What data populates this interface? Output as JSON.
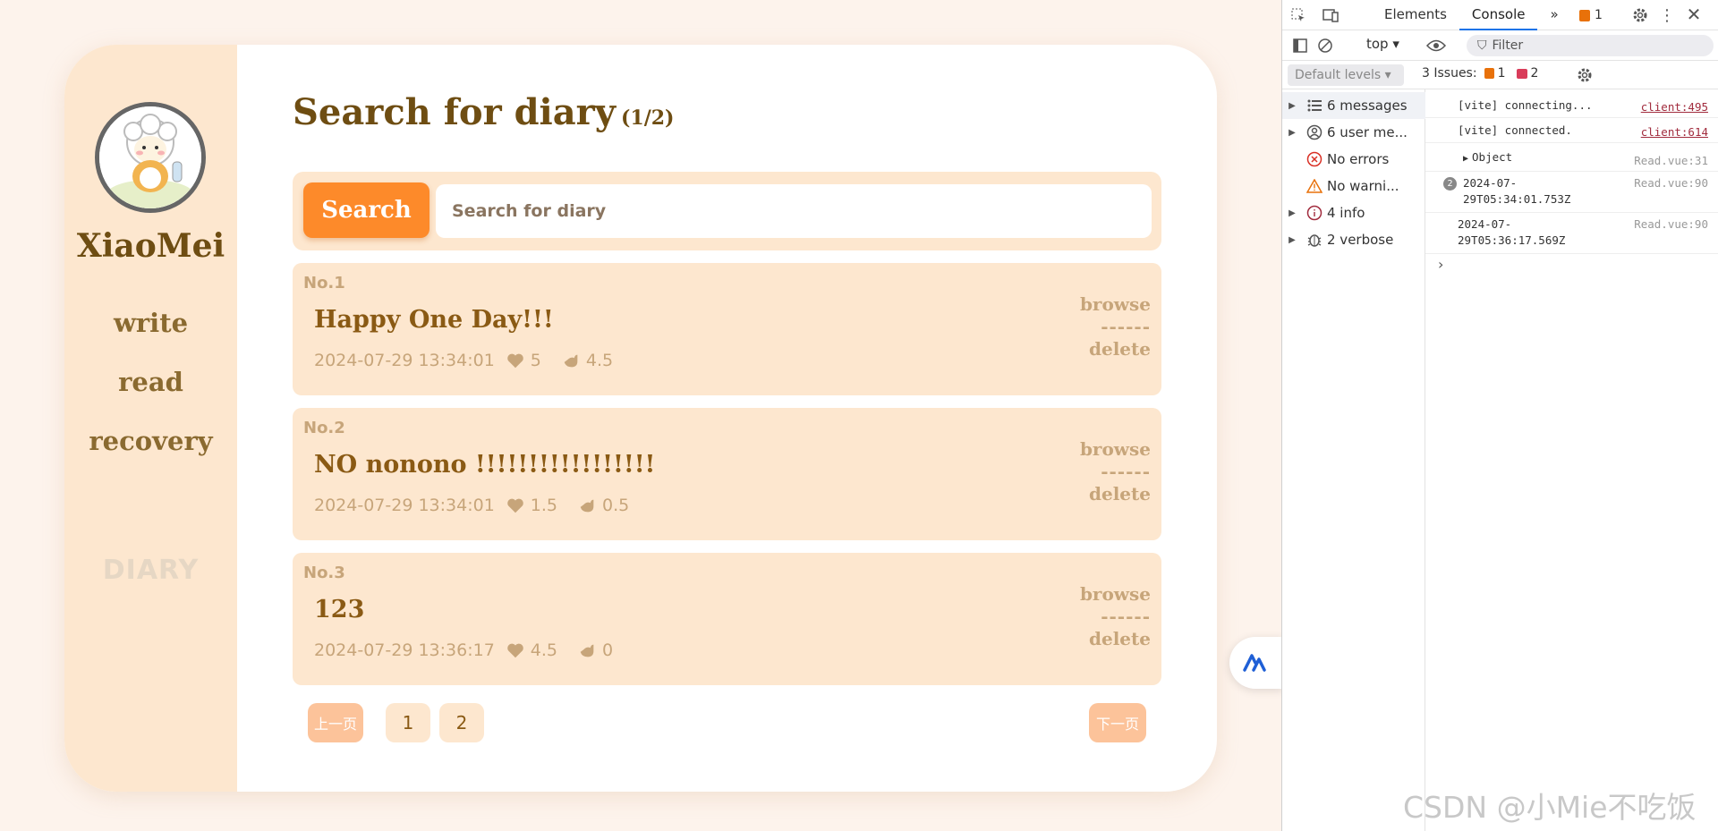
{
  "sidebar": {
    "username": "XiaoMei",
    "nav": [
      "write",
      "read",
      "recovery"
    ],
    "brand": "DIARY"
  },
  "main": {
    "title": "Search for diary",
    "page_count": "(1/2)",
    "search_button": "Search",
    "search_placeholder": "Search for diary",
    "entries": [
      {
        "no": "No.1",
        "title": "Happy One Day!!!",
        "date": "2024-07-29 13:34:01",
        "likes": "5",
        "rating": "4.5"
      },
      {
        "no": "No.2",
        "title": "NO nonono !!!!!!!!!!!!!!!!!",
        "date": "2024-07-29 13:34:01",
        "likes": "1.5",
        "rating": "0.5"
      },
      {
        "no": "No.3",
        "title": "123",
        "date": "2024-07-29 13:36:17",
        "likes": "4.5",
        "rating": "0"
      }
    ],
    "entry_actions": {
      "browse": "browse",
      "separator": "------",
      "delete": "delete"
    },
    "pager": {
      "prev": "上一页",
      "pages": [
        "1",
        "2"
      ],
      "next": "下一页"
    }
  },
  "devtools": {
    "tabs": [
      "Elements",
      "Console"
    ],
    "active_tab": "Console",
    "issue_badge_count": "1",
    "context": "top",
    "filter_placeholder": "Filter",
    "levels": "Default levels",
    "issues_label": "3 Issues:",
    "issues_warn": "1",
    "issues_info": "2",
    "sidebar_items": [
      {
        "label": "6 messages",
        "icon": "list-icon"
      },
      {
        "label": "6 user me...",
        "icon": "user-icon"
      },
      {
        "label": "No errors",
        "icon": "error-icon"
      },
      {
        "label": "No warni...",
        "icon": "warning-icon"
      },
      {
        "label": "4 info",
        "icon": "info-icon"
      },
      {
        "label": "2 verbose",
        "icon": "bug-icon"
      }
    ],
    "console_lines": [
      {
        "text": "[vite] connecting...",
        "src": "client:495"
      },
      {
        "text": "[vite] connected.",
        "src": "client:614"
      },
      {
        "text": "Object",
        "src": "Read.vue:31"
      },
      {
        "repeat": "2",
        "text1": "2024-07-",
        "text2": "29T05:34:01.753Z",
        "src": "Read.vue:90"
      },
      {
        "text1": "2024-07-",
        "text2": "29T05:36:17.569Z",
        "src": "Read.vue:90"
      }
    ],
    "prompt": "›"
  },
  "watermark": "CSDN @小Mie不吃饭",
  "colors": {
    "accent": "#fd8a2a",
    "panel": "#fde7cf",
    "brown": "#6e4d12",
    "muted": "#c7a57a"
  }
}
